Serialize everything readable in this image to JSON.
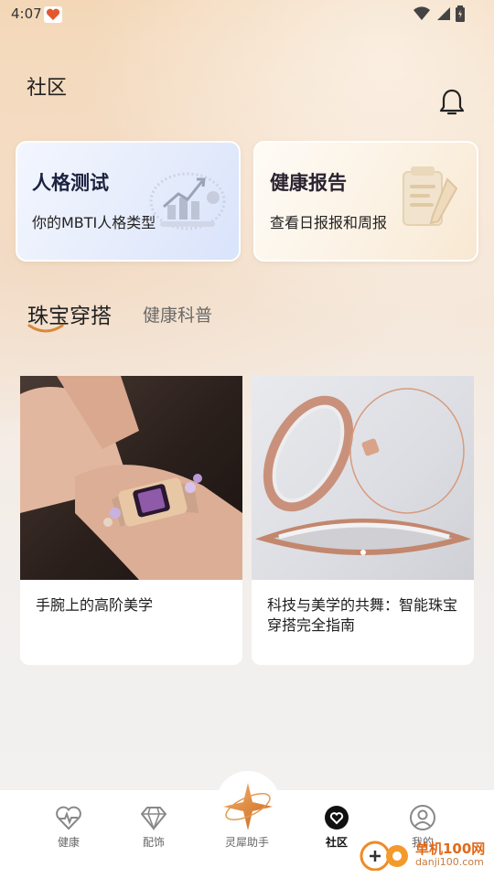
{
  "status_bar": {
    "time": "4:07"
  },
  "header": {
    "title": "社区"
  },
  "cards": [
    {
      "title": "人格测试",
      "subtitle": "你的MBTI人格类型"
    },
    {
      "title": "健康报告",
      "subtitle": "查看日报报和周报"
    }
  ],
  "tabs": [
    {
      "label": "珠宝穿搭",
      "active": true
    },
    {
      "label": "健康科普",
      "active": false
    }
  ],
  "feed": [
    {
      "title": "手腕上的高阶美学"
    },
    {
      "title": "科技与美学的共舞：智能珠宝穿搭完全指南"
    }
  ],
  "bottom_nav": [
    {
      "label": "健康",
      "icon": "heart-pulse-icon",
      "active": false
    },
    {
      "label": "配饰",
      "icon": "diamond-icon",
      "active": false
    },
    {
      "label": "灵犀助手",
      "icon": "star-logo-icon",
      "active": false
    },
    {
      "label": "社区",
      "icon": "community-heart-icon",
      "active": true
    },
    {
      "label": "我的",
      "icon": "user-icon",
      "active": false
    }
  ],
  "watermark": {
    "title": "单机100网",
    "url": "danji100.com"
  },
  "colors": {
    "accent": "#d8893a",
    "active_nav": "#111111"
  }
}
